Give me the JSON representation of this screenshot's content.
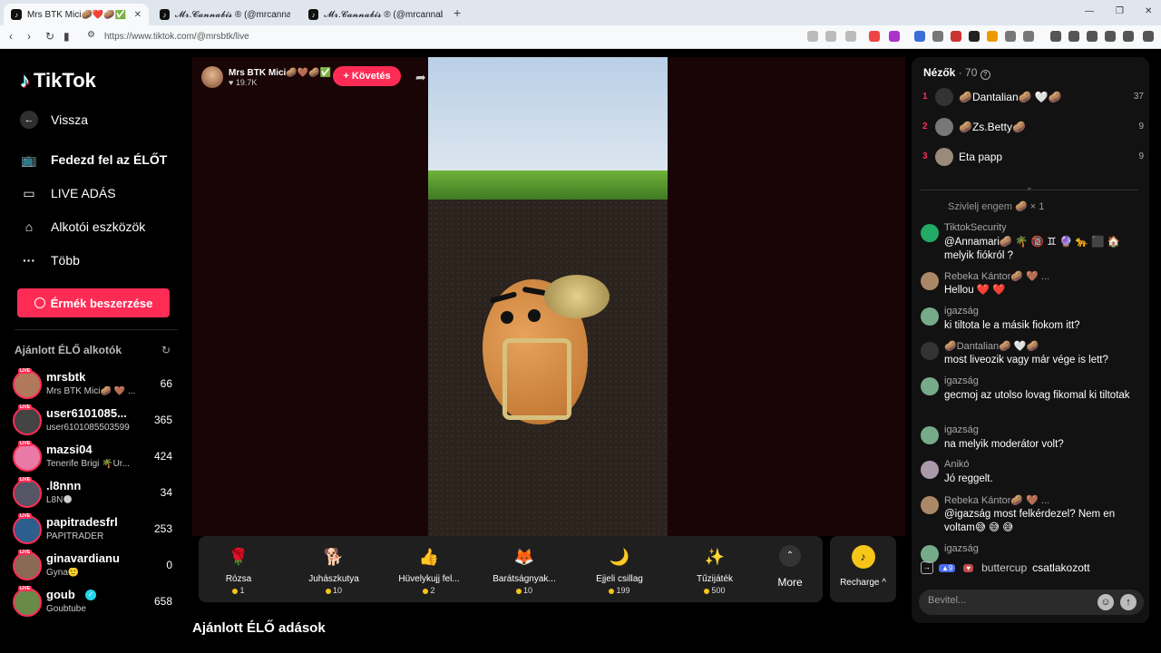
{
  "browser": {
    "tabs": [
      {
        "title": "Mrs BTK Mici🥔❤️🥔✅ (@m",
        "active": true
      },
      {
        "title": "𝓜𝓻.𝓒𝓪𝓷𝓷𝓪𝓫𝓲𝓼 ® (@mrcannabis_)",
        "active": false
      },
      {
        "title": "𝓜𝓻.𝓒𝓪𝓷𝓷𝓪𝓫𝓲𝓼 ® (@mrcannabis_)",
        "active": false
      }
    ],
    "url": "https://www.tiktok.com/@mrsbtk/live"
  },
  "sidebar": {
    "logo": "TikTok",
    "back": "Vissza",
    "nav": [
      {
        "label": "Fedezd fel az ÉLŐT",
        "icon": "tv-icon"
      },
      {
        "label": "LIVE ADÁS",
        "icon": "camera-icon"
      },
      {
        "label": "Alkotói eszközök",
        "icon": "house-icon"
      },
      {
        "label": "Több",
        "icon": "more-icon"
      }
    ],
    "coins_button": "Érmék beszerzése",
    "section_title": "Ajánlott ÉLŐ alkotók",
    "live_badge": "LIVE",
    "creators": [
      {
        "name": "mrsbtk",
        "sub": "Mrs BTK Mici🥔 🤎 ...",
        "count": "66",
        "color": "#b07a5a"
      },
      {
        "name": "user6101085...",
        "sub": "user6101085503599",
        "count": "365",
        "color": "#444"
      },
      {
        "name": "mazsi04",
        "sub": "Tenerife Brigi 🌴Úr...",
        "count": "424",
        "color": "#e97aa8"
      },
      {
        "name": ".l8nnn",
        "sub": "L8N🌑",
        "count": "34",
        "color": "#556"
      },
      {
        "name": "papitradesfrl",
        "sub": "PAPITRADER",
        "count": "253",
        "color": "#2c5f8d"
      },
      {
        "name": "ginavardianu",
        "sub": "Gyna🙂",
        "count": "0",
        "color": "#8a6a55"
      },
      {
        "name": "goub",
        "sub": "Goubtube",
        "count": "658",
        "color": "#6a8a4a"
      }
    ]
  },
  "stream": {
    "name": "Mrs BTK Mici🥔🤎🥔✅",
    "likes": "19.7K",
    "follow": "+ Követés"
  },
  "gifts": [
    {
      "name": "Rózsa",
      "price": "1",
      "icon": "rose-icon",
      "glyph": "🌹"
    },
    {
      "name": "Juhászkutya",
      "price": "10",
      "icon": "dog-icon",
      "glyph": "🐕"
    },
    {
      "name": "Hüvelykujj fel...",
      "price": "2",
      "icon": "thumbs-up-icon",
      "glyph": "👍"
    },
    {
      "name": "Barátságnyak...",
      "price": "10",
      "icon": "necklace-icon",
      "glyph": "🦊"
    },
    {
      "name": "Éjjeli csillag",
      "price": "199",
      "icon": "night-star-icon",
      "glyph": "🌙"
    },
    {
      "name": "Tűzijáték",
      "price": "500",
      "icon": "firework-icon",
      "glyph": "✨"
    }
  ],
  "more_label": "More",
  "recharge_label": "Recharge ^",
  "recommended_heading": "Ajánlott ÉLŐ adások",
  "chat": {
    "viewers_label": "Nézők",
    "viewers_count": "· 70",
    "top_viewers": [
      {
        "rank": "1",
        "name": "🥔Dantalian🥔 🤍🥔",
        "score": "37"
      },
      {
        "rank": "2",
        "name": "🥔Zs.Betty🥔",
        "score": "9"
      },
      {
        "rank": "3",
        "name": "Eta papp",
        "score": "9"
      }
    ],
    "system_message": "Szivlelj engem 🥔 × 1",
    "messages": [
      {
        "user": "TiktokSecurity",
        "text": "@Annamari🥔 🌴 🔞 ♊ 🔮 🐆 ⬛ 🏠 melyik fiókról ?"
      },
      {
        "user": "Rebeka Kántor🥔 🤎 ...",
        "text": "Hellou ❤️ ❤️"
      },
      {
        "user": "igazság",
        "text": "ki tiltota le a másik fiokom itt?"
      },
      {
        "user": "🥔Dantalian🥔 🤍🥔",
        "text": "most liveozik vagy már vége is lett?"
      },
      {
        "user": "igazság",
        "text": "gecmoj az utolso lovag fikomal ki tiltotak"
      },
      {
        "user": "igazság",
        "text": "na melyik moderátor volt?"
      },
      {
        "user": "Anikó",
        "text": "Jó reggelt."
      },
      {
        "user": "Rebeka Kántor🥔 🤎 ...",
        "text": "@igazság most felkérdezel? Nem en voltam😅 😅 😅"
      },
      {
        "user": "igazság",
        "text": ""
      }
    ],
    "joined_user": "buttercup",
    "joined_text": "csatlakozott",
    "input_placeholder": "Bevitel..."
  }
}
